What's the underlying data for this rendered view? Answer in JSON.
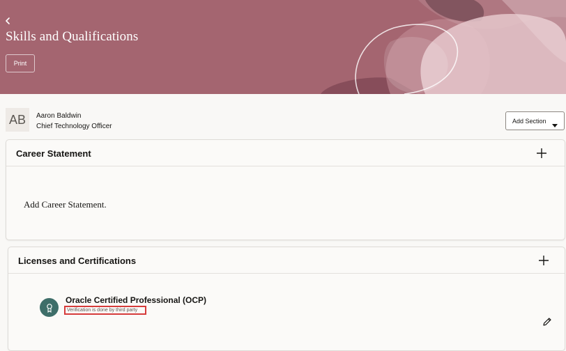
{
  "banner": {
    "title": "Skills and Qualifications",
    "print_label": "Print",
    "colors": {
      "background": "#a46570",
      "light": "#e6c8cd",
      "dark": "#6b3a45"
    }
  },
  "person": {
    "initials": "AB",
    "name": "Aaron Baldwin",
    "role": "Chief Technology Officer"
  },
  "add_section": {
    "label": "Add Section",
    "icon": "caret-down-icon"
  },
  "career": {
    "title": "Career Statement",
    "empty_text": "Add Career Statement.",
    "add_icon": "plus-icon"
  },
  "licenses": {
    "title": "Licenses and Certifications",
    "add_icon": "plus-icon",
    "items": [
      {
        "name": "Oracle Certified Professional (OCP)",
        "verification": "Verification is done by third party",
        "icon": "certificate-icon",
        "edit_icon": "pencil-icon"
      }
    ]
  }
}
